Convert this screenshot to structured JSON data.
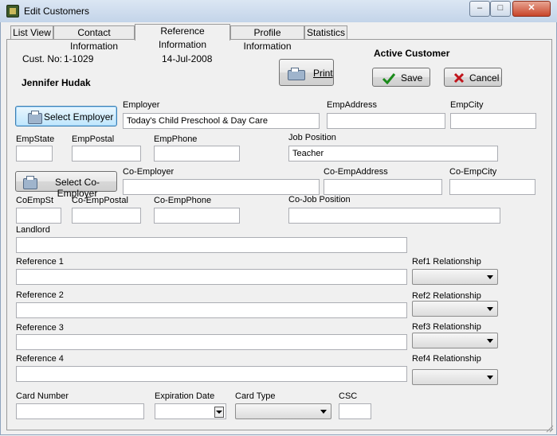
{
  "window": {
    "title": "Edit Customers",
    "min_glyph": "–",
    "max_glyph": "□",
    "close_glyph": "✕"
  },
  "tabs": [
    {
      "label": "List View",
      "active": false
    },
    {
      "label": "Contact Information",
      "active": false
    },
    {
      "label": "Reference Information",
      "active": true
    },
    {
      "label": "Profile Information",
      "active": false
    },
    {
      "label": "Statistics",
      "active": false
    }
  ],
  "customer": {
    "cust_no_label": "Cust. No:",
    "cust_no": "1-1029",
    "date": "14-Jul-2008",
    "name": "Jennifer Hudak",
    "status": "Active Customer"
  },
  "buttons": {
    "print": "Print",
    "save": "Save",
    "cancel": "Cancel",
    "select_employer": "Select Employer",
    "select_co_employer": "Select Co-Employer"
  },
  "employer": {
    "employer_label": "Employer",
    "employer_value": "Today's Child Preschool & Day Care",
    "address_label": "EmpAddress",
    "address_value": "",
    "city_label": "EmpCity",
    "city_value": "",
    "state_label": "EmpState",
    "state_value": "",
    "postal_label": "EmpPostal",
    "postal_value": "",
    "phone_label": "EmpPhone",
    "phone_value": "",
    "job_label": "Job Position",
    "job_value": "Teacher"
  },
  "co_employer": {
    "employer_label": "Co-Employer",
    "employer_value": "",
    "address_label": "Co-EmpAddress",
    "address_value": "",
    "city_label": "Co-EmpCity",
    "city_value": "",
    "state_label": "CoEmpSt",
    "state_value": "",
    "postal_label": "Co-EmpPostal",
    "postal_value": "",
    "phone_label": "Co-EmpPhone",
    "phone_value": "",
    "job_label": "Co-Job Position",
    "job_value": ""
  },
  "landlord": {
    "label": "Landlord",
    "value": ""
  },
  "references": [
    {
      "label": "Reference 1",
      "value": "",
      "rel_label": "Ref1 Relationship",
      "rel_value": ""
    },
    {
      "label": "Reference 2",
      "value": "",
      "rel_label": "Ref2 Relationship",
      "rel_value": ""
    },
    {
      "label": "Reference 3",
      "value": "",
      "rel_label": "Ref3 Relationship",
      "rel_value": ""
    },
    {
      "label": "Reference 4",
      "value": "",
      "rel_label": "Ref4 Relationship",
      "rel_value": ""
    }
  ],
  "card": {
    "number_label": "Card Number",
    "number_value": "",
    "expiration_label": "Expiration Date",
    "expiration_value": "",
    "type_label": "Card Type",
    "type_value": "",
    "csc_label": "CSC",
    "csc_value": ""
  },
  "colors": {
    "save_check": "#1a8a1a",
    "cancel_x": "#c0141b",
    "focus_border": "#3c7fb1"
  },
  "icons": {
    "print": "printer-icon",
    "save": "checkmark-icon",
    "cancel": "x-icon",
    "select_employer": "printer-icon"
  }
}
